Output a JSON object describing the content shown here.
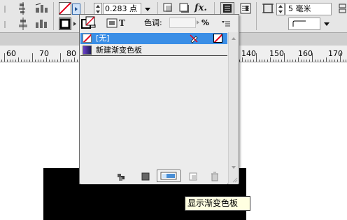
{
  "toolbar": {
    "stroke_weight_value": "0.283 点",
    "fx_label": "fx.",
    "corner_size_value": "5 毫米",
    "tint_label": "色调:",
    "tint_value": "",
    "tint_unit": "%",
    "text_t_label": "T"
  },
  "ruler": {
    "labels": [
      "60",
      "70",
      "80",
      "140",
      "150",
      "160",
      "170"
    ]
  },
  "swatches_panel": {
    "items": [
      {
        "label": "[无]",
        "selected": true
      },
      {
        "label": "新建渐变色板",
        "selected": false
      }
    ]
  },
  "tooltip": {
    "text": "显示渐变色板"
  },
  "colors": {
    "selection_blue": "#3a8ee6",
    "none_red": "#e3001b",
    "canvas_black": "#000000",
    "tooltip_bg": "#ffffe1"
  }
}
